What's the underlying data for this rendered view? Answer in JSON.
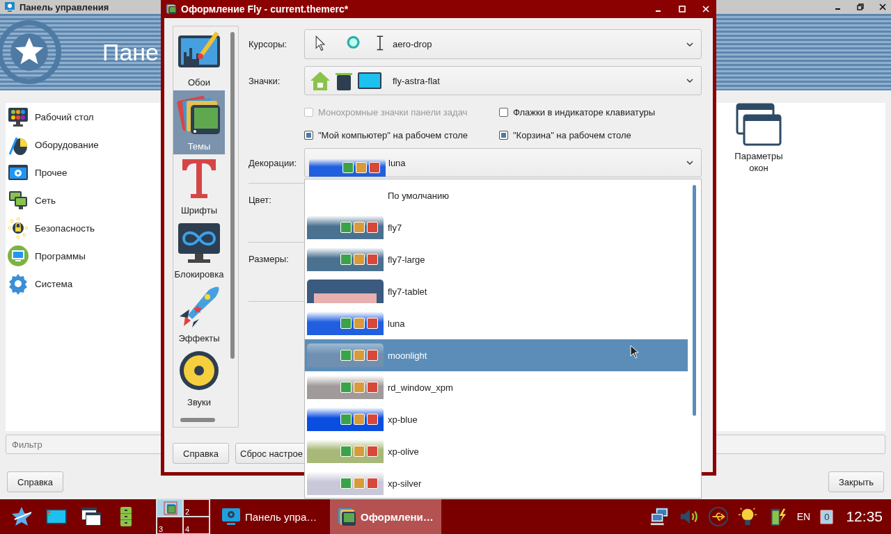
{
  "back_window": {
    "title": "Панель управления",
    "banner_title": "Пане",
    "categories": [
      {
        "label": "Рабочий стол"
      },
      {
        "label": "Оборудование"
      },
      {
        "label": "Прочее"
      },
      {
        "label": "Сеть"
      },
      {
        "label": "Безопасность"
      },
      {
        "label": "Программы"
      },
      {
        "label": "Система"
      }
    ],
    "applets": [
      {
        "label": "Параметры окон"
      }
    ],
    "filter": {
      "placeholder": "Фильтр"
    },
    "buttons": [
      "Справка",
      "Закрыть"
    ]
  },
  "dialog": {
    "title": "Оформление Fly - current.themerc*",
    "sections": [
      {
        "label": "Обои",
        "selected": false
      },
      {
        "label": "Темы",
        "selected": true
      },
      {
        "label": "Шрифты",
        "selected": false
      },
      {
        "label": "Блокировка",
        "selected": false
      },
      {
        "label": "Эффекты",
        "selected": false
      },
      {
        "label": "Звуки",
        "selected": false
      }
    ],
    "cursors": {
      "label": "Курсоры:",
      "value": "aero-drop"
    },
    "icons": {
      "label": "Значки:",
      "value": "fly-astra-flat"
    },
    "options": [
      {
        "label": "Монохромные значки панели задач",
        "checked": false,
        "disabled": true
      },
      {
        "label": "Флажки в индикаторе клавиатуры",
        "checked": false,
        "disabled": false
      },
      {
        "label": "\"Мой компьютер\" на рабочем столе",
        "checked": true,
        "disabled": false
      },
      {
        "label": "\"Корзина\" на рабочем столе",
        "checked": true,
        "disabled": false
      }
    ],
    "decorations": {
      "label": "Декорации:",
      "value": "luna",
      "kind": "bar",
      "color": "#1f5fe0"
    },
    "color_label": "Цвет:",
    "sizes_label": "Размеры:",
    "buttons": [
      "Справка",
      "Сброс настрое"
    ]
  },
  "decorations_menu": [
    {
      "label": "По умолчанию",
      "kind": "none",
      "selected": false
    },
    {
      "label": "fly7",
      "kind": "bar",
      "color": "#4a7190",
      "selected": false
    },
    {
      "label": "fly7-large",
      "kind": "bar",
      "color": "#4a7190",
      "selected": false
    },
    {
      "label": "fly7-tablet",
      "kind": "tablet",
      "color": "#3a5a80",
      "selected": false
    },
    {
      "label": "luna",
      "kind": "bar",
      "color": "#1f5fe0",
      "selected": false
    },
    {
      "label": "moonlight",
      "kind": "bar",
      "color": "#6f90b0",
      "selected": true
    },
    {
      "label": "rd_window_xpm",
      "kind": "bar",
      "color": "#a09a9a",
      "selected": false
    },
    {
      "label": "xp-blue",
      "kind": "bar",
      "color": "#0a4ee0",
      "selected": false
    },
    {
      "label": "xp-olive",
      "kind": "bar",
      "color": "#a8b878",
      "selected": false
    },
    {
      "label": "xp-silver",
      "kind": "bar",
      "color": "#c8c8d8",
      "selected": false
    }
  ],
  "taskbar": {
    "desktops": [
      {
        "selected": true
      },
      {
        "label": "2",
        "selected": false
      },
      {
        "label": "3",
        "selected": false
      },
      {
        "label": "4",
        "selected": false
      }
    ],
    "tasks": [
      {
        "label": "Панель упра…",
        "selected": false
      },
      {
        "label": "Оформлени…",
        "selected": true
      }
    ],
    "language": "EN",
    "notifications": "0",
    "clock": "12:35"
  }
}
